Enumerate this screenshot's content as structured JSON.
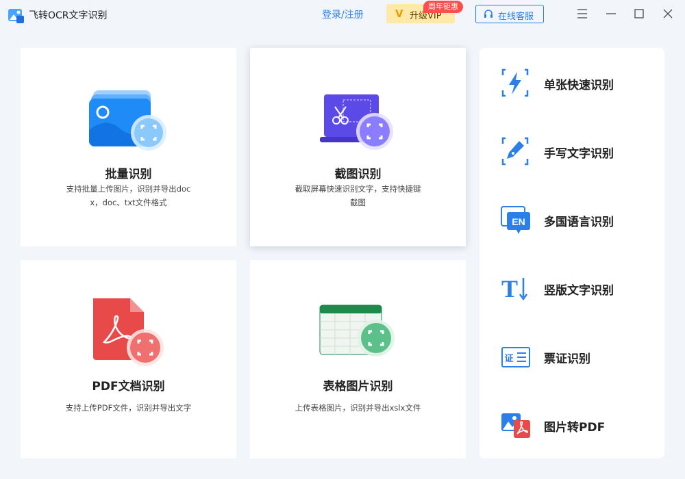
{
  "app": {
    "title": "飞转OCR文字识别"
  },
  "header": {
    "login": "登录/注册",
    "vip_label": "升级VIP",
    "vip_badge": "周年钜惠",
    "service": "在线客服"
  },
  "cards": [
    {
      "title": "批量识别",
      "desc": "支持批量上传图片，识别并导出doc",
      "desc2": "x，doc、txt文件格式",
      "icon": "batch-images-icon"
    },
    {
      "title": "截图识别",
      "desc": "截取屏幕快速识别文字，支持快捷键",
      "desc2": "截图",
      "icon": "screenshot-scissors-icon"
    },
    {
      "title": "PDF文档识别",
      "desc": "支持上传PDF文件，识别并导出文字",
      "desc2": "",
      "icon": "pdf-file-icon"
    },
    {
      "title": "表格图片识别",
      "desc": "上传表格图片，识别并导出xslx文件",
      "desc2": "",
      "icon": "spreadsheet-icon"
    }
  ],
  "side": [
    {
      "label": "单张快速识别",
      "icon": "lightning-scan-icon"
    },
    {
      "label": "手写文字识别",
      "icon": "pen-scan-icon"
    },
    {
      "label": "多国语言识别",
      "icon": "language-en-icon",
      "icon_text": "EN"
    },
    {
      "label": "竖版文字识别",
      "icon": "vertical-text-icon",
      "icon_text": "T"
    },
    {
      "label": "票证识别",
      "icon": "certificate-icon",
      "icon_text": "证"
    },
    {
      "label": "图片转PDF",
      "icon": "image-to-pdf-icon"
    }
  ],
  "colors": {
    "accent": "#2a7fe8",
    "vip": "#ffe9a8",
    "badge": "#ff4c4c",
    "pdf": "#e84a4a",
    "sheet": "#1e8a4c"
  }
}
